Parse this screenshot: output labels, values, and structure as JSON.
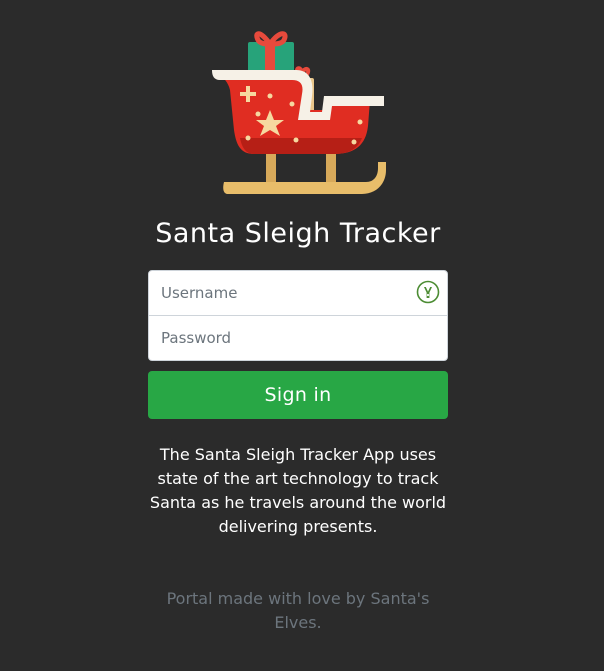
{
  "app": {
    "title": "Santa Sleigh Tracker",
    "logo_icon": "sleigh-with-presents-icon"
  },
  "login_form": {
    "username_placeholder": "Username",
    "username_value": "",
    "username_icon": "password-manager-icon",
    "password_placeholder": "Password",
    "password_value": "",
    "submit_label": "Sign in"
  },
  "description": "The Santa Sleigh Tracker App uses state of the art technology to track Santa as he travels around the world delivering presents.",
  "footer": "Portal made with love by Santa's Elves.",
  "colors": {
    "background": "#2b2b2b",
    "primary_button": "#28a745",
    "sleigh_red": "#e02d22",
    "runner_gold": "#e8bd6a",
    "footer_text": "#6c757d"
  }
}
